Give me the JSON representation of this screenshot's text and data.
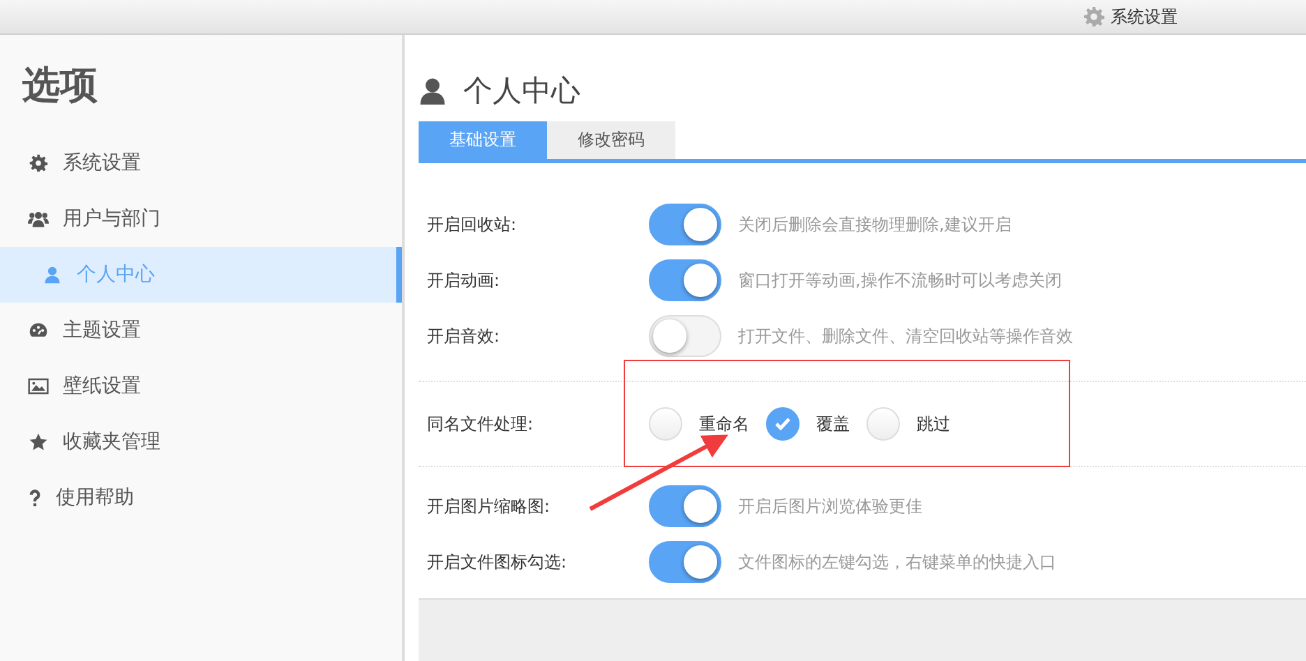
{
  "topbar": {
    "label": "系统设置"
  },
  "sidebar": {
    "title": "选项",
    "items": [
      {
        "label": "系统设置",
        "selected": false
      },
      {
        "label": "用户与部门",
        "selected": false,
        "children": [
          {
            "label": "个人中心",
            "selected": true
          }
        ]
      },
      {
        "label": "主题设置",
        "selected": false
      },
      {
        "label": "壁纸设置",
        "selected": false
      },
      {
        "label": "收藏夹管理",
        "selected": false
      },
      {
        "label": "使用帮助",
        "selected": false
      }
    ]
  },
  "page": {
    "title": "个人中心",
    "tabs": [
      {
        "label": "基础设置",
        "selected": true
      },
      {
        "label": "修改密码",
        "selected": false
      }
    ],
    "settings": [
      {
        "kind": "toggle",
        "label": "开启回收站:",
        "on": true,
        "hint": "关闭后删除会直接物理删除,建议开启"
      },
      {
        "kind": "toggle",
        "label": "开启动画:",
        "on": true,
        "hint": "窗口打开等动画,操作不流畅时可以考虑关闭"
      },
      {
        "kind": "toggle",
        "label": "开启音效:",
        "on": false,
        "hint": "打开文件、删除文件、清空回收站等操作音效"
      },
      {
        "kind": "radio",
        "label": "同名文件处理:",
        "options": [
          {
            "label": "重命名",
            "selected": false
          },
          {
            "label": "覆盖",
            "selected": true
          },
          {
            "label": "跳过",
            "selected": false
          }
        ]
      },
      {
        "kind": "toggle",
        "label": "开启图片缩略图:",
        "on": true,
        "hint": "开启后图片浏览体验更佳"
      },
      {
        "kind": "toggle",
        "label": "开启文件图标勾选:",
        "on": true,
        "hint": "文件图标的左键勾选，右键菜单的快捷入口"
      }
    ]
  }
}
